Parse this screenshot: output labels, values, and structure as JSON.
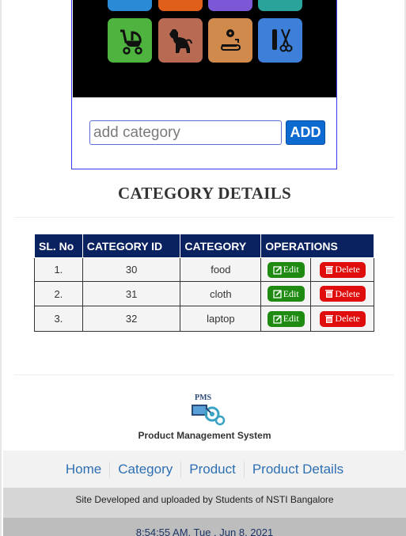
{
  "add_form": {
    "placeholder": "add category",
    "button_label": "ADD"
  },
  "section_title": "CATEGORY DETAILS",
  "table": {
    "headers": [
      "SL. No",
      "CATEGORY ID",
      "CATEGORY",
      "OPERATIONS"
    ],
    "rows": [
      {
        "sl": "1.",
        "id": "30",
        "category": "food"
      },
      {
        "sl": "2.",
        "id": "31",
        "category": "cloth"
      },
      {
        "sl": "3.",
        "id": "32",
        "category": "laptop"
      }
    ],
    "edit_label": "Edit",
    "delete_label": "Delete"
  },
  "footer": {
    "logo_text": "PMS",
    "app_name": "Product Management System",
    "nav": [
      "Home",
      "Category",
      "Product",
      "Product Details"
    ],
    "credit": "Site Developed and uploaded by Students of NSTI Bangalore",
    "clock": "8:54:55 AM, Tue , Jun 8, 2021"
  },
  "colors": {
    "header_bg": "#0b2261",
    "add_button": "#0d6ad1",
    "edit_button": "#1f8b12",
    "delete_button": "#e00d0d",
    "nav_link": "#2d6fb3"
  },
  "icons": [
    "stroller-icon",
    "dog-icon",
    "sewing-machine-icon",
    "scissors-icon"
  ]
}
